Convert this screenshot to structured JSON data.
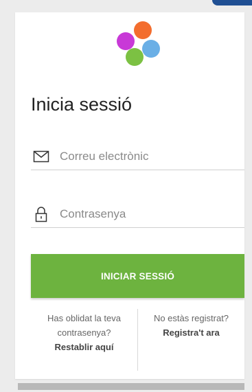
{
  "title": "Inicia sessió",
  "email": {
    "placeholder": "Correu electrònic",
    "value": "",
    "icon": "envelope-icon"
  },
  "password": {
    "placeholder": "Contrasenya",
    "value": "",
    "icon": "lock-icon"
  },
  "login_button": {
    "label": "INICIAR SESSIÓ",
    "color": "#6db33f"
  },
  "forgot": {
    "line1": "Has oblidat la teva",
    "line2": "contrasenya?",
    "link": "Restablir aquí"
  },
  "register": {
    "line1": "No estàs registrat?",
    "link": "Registra't ara"
  },
  "logo": {
    "colors": [
      "#f36d2e",
      "#c839d7",
      "#6aafe6",
      "#7cc143"
    ]
  }
}
